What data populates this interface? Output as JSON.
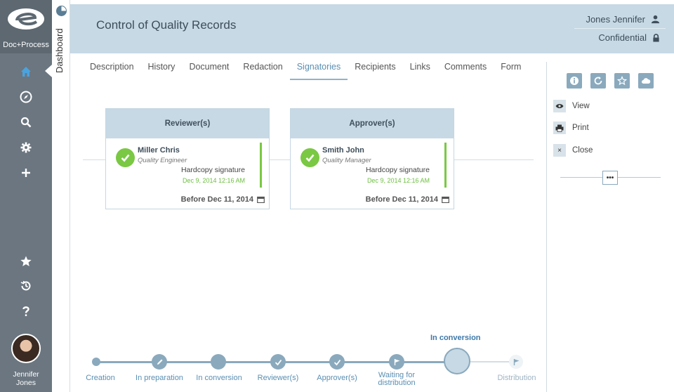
{
  "app": {
    "logo_text": "Doc+Process",
    "dashboard_label": "Dashboard"
  },
  "header": {
    "title": "Control of Quality Records",
    "user": "Jones Jennifer",
    "classification": "Confidential"
  },
  "tabs": [
    {
      "label": "Description"
    },
    {
      "label": "History"
    },
    {
      "label": "Document"
    },
    {
      "label": "Redaction"
    },
    {
      "label": "Signatories",
      "active": true
    },
    {
      "label": "Recipients"
    },
    {
      "label": "Links"
    },
    {
      "label": "Comments"
    },
    {
      "label": "Form"
    }
  ],
  "sidebar": {
    "icons": [
      "home-icon",
      "compass-icon",
      "search-icon",
      "gear-icon",
      "plus-icon",
      "star-icon",
      "history-icon",
      "help-icon"
    ],
    "user_first": "Jennifer",
    "user_last": "Jones"
  },
  "cards": [
    {
      "title": "Reviewer(s)",
      "name": "Miller Chris",
      "role": "Quality Engineer",
      "signature": "Hardcopy signature",
      "signed_at": "Dec 9, 2014 12:16 AM",
      "due": "Before Dec 11, 2014"
    },
    {
      "title": "Approver(s)",
      "name": "Smith John",
      "role": "Quality Manager",
      "signature": "Hardcopy signature",
      "signed_at": "Dec 9, 2014 12:16 AM",
      "due": "Before Dec 11, 2014"
    }
  ],
  "right_panel": {
    "tools": [
      "info-icon",
      "refresh-icon",
      "star-icon",
      "cloud-icon"
    ],
    "actions": [
      {
        "label": "View",
        "icon": "eye-icon"
      },
      {
        "label": "Print",
        "icon": "print-icon"
      },
      {
        "label": "Close",
        "icon": "close-icon",
        "glyph": "×"
      }
    ],
    "slider_glyph": "•••"
  },
  "workflow": {
    "current_label": "In conversion",
    "steps": [
      {
        "label": "Creation"
      },
      {
        "label": "In preparation"
      },
      {
        "label": "In conversion"
      },
      {
        "label": "Reviewer(s)"
      },
      {
        "label": "Approver(s)"
      },
      {
        "label_line1": "Waiting for",
        "label_line2": "distribution"
      },
      {
        "label": ""
      },
      {
        "label": "Distribution"
      }
    ]
  },
  "colors": {
    "accent": "#8aa9bd",
    "header_bg": "#c6d9e5",
    "sidebar_bg": "#6b7680",
    "success": "#7ac843",
    "link": "#5b8fb2"
  }
}
